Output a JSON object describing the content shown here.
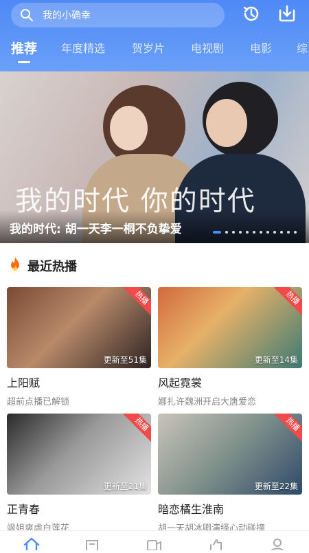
{
  "search": {
    "placeholder": "我的小确幸"
  },
  "tabs": [
    {
      "label": "推荐",
      "active": true
    },
    {
      "label": "年度精选",
      "active": false
    },
    {
      "label": "贺岁片",
      "active": false
    },
    {
      "label": "电视剧",
      "active": false
    },
    {
      "label": "电影",
      "active": false
    },
    {
      "label": "综",
      "active": false
    }
  ],
  "banner": {
    "art_text": "我的时代 你的时代",
    "caption": "我的时代: 胡一天李一桐不负挚爱",
    "slide_count": 12,
    "active_slide": 1
  },
  "section": {
    "title": "最近热播",
    "icon": "fire-icon"
  },
  "cards": [
    {
      "name": "上阳赋",
      "desc": "超前点播已解锁",
      "episodes": "更新至51集",
      "badge": "热播",
      "palette": [
        "#6b3b2a",
        "#b88a6a",
        "#3a2a2a"
      ]
    },
    {
      "name": "风起霓裳",
      "desc": "娜扎许魏洲开启大唐爱恋",
      "episodes": "更新至14集",
      "badge": "热播",
      "palette": [
        "#c8643a",
        "#e2a15c",
        "#2f6f6a"
      ]
    },
    {
      "name": "正青春",
      "desc": "飒姐爽虐白莲花",
      "episodes": "更新至21集",
      "badge": "热播",
      "palette": [
        "#2a2a2a",
        "#8d8d8d",
        "#d8d8d8"
      ]
    },
    {
      "name": "暗恋橘生淮南",
      "desc": "胡一天胡冰卿演绎心动碰撞",
      "episodes": "更新至22集",
      "badge": "热播",
      "palette": [
        "#2e4a6a",
        "#7e8f8a",
        "#c9c4b9"
      ]
    }
  ],
  "colors": {
    "accent": "#4e89f6",
    "hot_badge": "#f04a4a"
  },
  "bottom_nav": [
    {
      "icon": "home-icon",
      "active": true
    },
    {
      "icon": "channel-icon",
      "active": false
    },
    {
      "icon": "video-icon",
      "active": false
    },
    {
      "icon": "thumb-icon",
      "active": false
    },
    {
      "icon": "profile-icon",
      "active": false
    }
  ]
}
